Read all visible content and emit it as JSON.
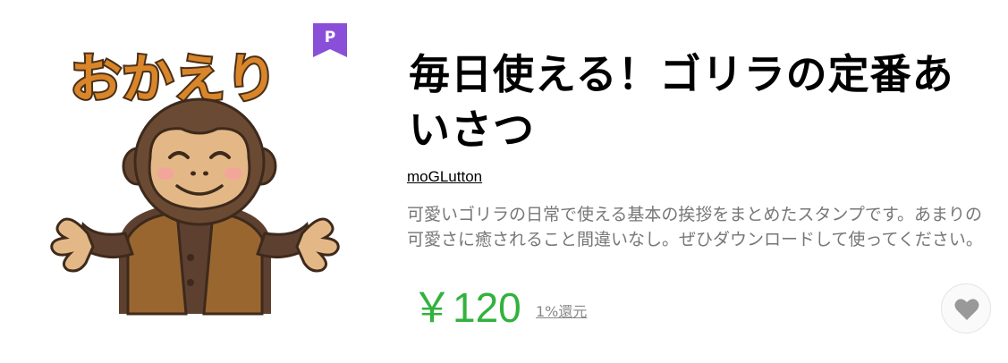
{
  "product": {
    "title": "毎日使える！ゴリラの定番あいさつ",
    "author": "moGLutton",
    "description": "可愛いゴリラの日常で使える基本の挨拶をまとめたスタンプです。あまりの可愛さに癒されること間違いなし。ぜひダウンロードして使ってください。",
    "price": "￥120",
    "cashback": "1%還元"
  },
  "badge": {
    "label": "P",
    "color": "#8a4fd8"
  },
  "sticker": {
    "text": "おかえり",
    "icon": "gorilla-sticker"
  },
  "favorite": {
    "icon": "heart-icon"
  },
  "colors": {
    "price": "#32b23d",
    "description": "#777777",
    "badge": "#8a4fd8"
  }
}
